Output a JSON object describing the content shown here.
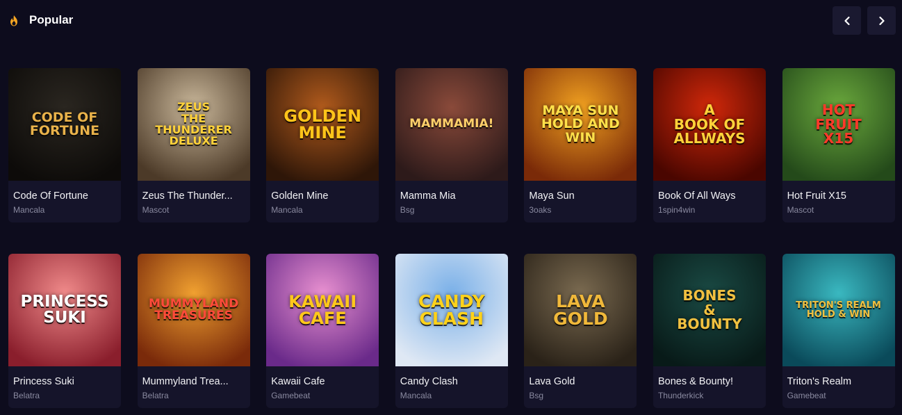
{
  "section": {
    "title": "Popular",
    "icon": "fire-icon",
    "accent": "#f5a623"
  },
  "nav": {
    "prev_icon": "chevron-left-icon",
    "next_icon": "chevron-right-icon"
  },
  "games": [
    {
      "name": "Code Of Fortune",
      "provider": "Mancala",
      "logo": "Code of\nFortune",
      "bg1": "#2a2620",
      "bg2": "#0d0b09",
      "logo_color": "#e9b24a",
      "logo_size": 19
    },
    {
      "name": "Zeus The Thunder...",
      "provider": "Mascot",
      "logo": "Zeus\nthe thunderer\nDeluxe",
      "bg1": "#c9b79a",
      "bg2": "#4c3a28",
      "logo_color": "#ffd23a",
      "logo_size": 16
    },
    {
      "name": "Golden Mine",
      "provider": "Mancala",
      "logo": "Golden\nMine",
      "bg1": "#b05a1c",
      "bg2": "#2e1608",
      "logo_color": "#ffc41a",
      "logo_size": 24
    },
    {
      "name": "Mamma Mia",
      "provider": "Bsg",
      "logo": "MammaMia!",
      "bg1": "#8a4a3a",
      "bg2": "#2d1a1a",
      "logo_color": "#ffd06a",
      "logo_size": 17
    },
    {
      "name": "Maya Sun",
      "provider": "3oaks",
      "logo": "Maya Sun\nhold and win",
      "bg1": "#f0a020",
      "bg2": "#7a2a08",
      "logo_color": "#ffe14a",
      "logo_size": 19
    },
    {
      "name": "Book Of All Ways",
      "provider": "1spin4win",
      "logo": "A\nBook of\nAllways",
      "bg1": "#d0280a",
      "bg2": "#4a0600",
      "logo_color": "#ffd23a",
      "logo_size": 20
    },
    {
      "name": "Hot Fruit X15",
      "provider": "Mascot",
      "logo": "Hot\nFruit\nX15",
      "bg1": "#6aa83c",
      "bg2": "#244a1a",
      "logo_color": "#ff3a2a",
      "logo_size": 20
    },
    {
      "name": "Princess Suki",
      "provider": "Belatra",
      "logo": "Princess\nSuki",
      "bg1": "#f08a8a",
      "bg2": "#8a1e2c",
      "logo_color": "#ffffff",
      "logo_size": 23
    },
    {
      "name": "Mummyland Trea...",
      "provider": "Belatra",
      "logo": "Mummyland\nTreasures",
      "bg1": "#f0a030",
      "bg2": "#7a2a0a",
      "logo_color": "#ff4a3a",
      "logo_size": 17
    },
    {
      "name": "Kawaii Cafe",
      "provider": "Gamebeat",
      "logo": "Kawaii\nCafe",
      "bg1": "#e890d0",
      "bg2": "#6a2a8a",
      "logo_color": "#ffc81a",
      "logo_size": 24
    },
    {
      "name": "Candy Clash",
      "provider": "Mancala",
      "logo": "Candy\nClash",
      "bg1": "#7ab0e8",
      "bg2": "#dfe8f4",
      "logo_color": "#ffd21a",
      "logo_size": 25
    },
    {
      "name": "Lava Gold",
      "provider": "Bsg",
      "logo": "Lava\nGold",
      "bg1": "#7a6a50",
      "bg2": "#2a2218",
      "logo_color": "#f0b83a",
      "logo_size": 25
    },
    {
      "name": "Bones & Bounty!",
      "provider": "Thunderkick",
      "logo": "Bones\n&\nBounty",
      "bg1": "#1a4a44",
      "bg2": "#081a18",
      "logo_color": "#f0c040",
      "logo_size": 20
    },
    {
      "name": "Triton's Realm",
      "provider": "Gamebeat",
      "logo": "Triton's Realm\nhold & win",
      "bg1": "#3ab8c0",
      "bg2": "#0a4a5a",
      "logo_color": "#f0c040",
      "logo_size": 13
    }
  ]
}
